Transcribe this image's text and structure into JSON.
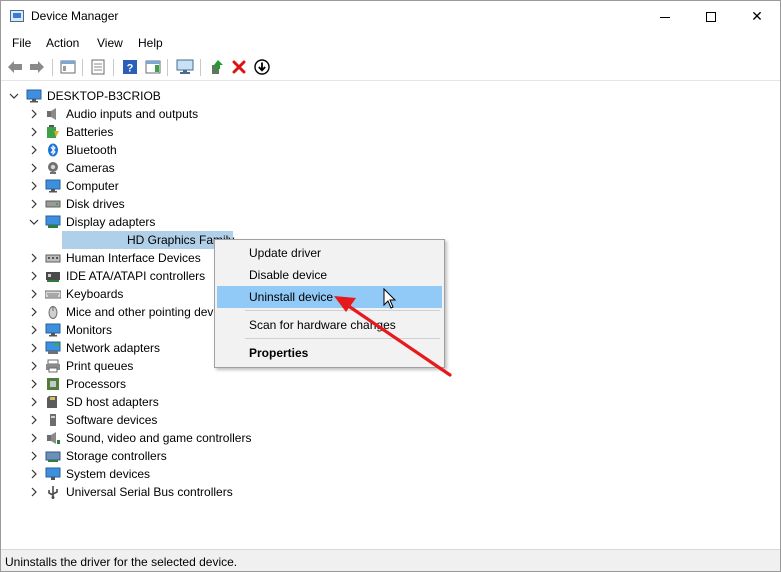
{
  "window": {
    "title": "Device Manager"
  },
  "menu": [
    "File",
    "Action",
    "View",
    "Help"
  ],
  "toolbar": {
    "icons": [
      "back-arrow-icon",
      "forward-arrow-icon",
      "console-tree-icon",
      "properties-sheet-icon",
      "help-icon",
      "action-pane-icon",
      "monitor-icon",
      "update-driver-icon",
      "uninstall-x-icon",
      "download-icon"
    ]
  },
  "tree": {
    "root": "DESKTOP-B3CRIOB",
    "categories": [
      {
        "label": "Audio inputs and outputs",
        "icon": "speaker-icon"
      },
      {
        "label": "Batteries",
        "icon": "battery-icon"
      },
      {
        "label": "Bluetooth",
        "icon": "bluetooth-icon"
      },
      {
        "label": "Cameras",
        "icon": "camera-icon"
      },
      {
        "label": "Computer",
        "icon": "computer-icon"
      },
      {
        "label": "Disk drives",
        "icon": "disk-drive-icon"
      },
      {
        "label": "Display adapters",
        "icon": "display-adapter-icon",
        "expanded": true,
        "child": "HD Graphics Family"
      },
      {
        "label": "Human Interface Devices",
        "icon": "hid-icon"
      },
      {
        "label": "IDE ATA/ATAPI controllers",
        "icon": "ide-controller-icon"
      },
      {
        "label": "Keyboards",
        "icon": "keyboard-icon"
      },
      {
        "label": "Mice and other pointing devices",
        "icon": "mouse-icon"
      },
      {
        "label": "Monitors",
        "icon": "monitor-icon"
      },
      {
        "label": "Network adapters",
        "icon": "network-adapter-icon"
      },
      {
        "label": "Print queues",
        "icon": "printer-icon"
      },
      {
        "label": "Processors",
        "icon": "processor-icon"
      },
      {
        "label": "SD host adapters",
        "icon": "sd-card-icon"
      },
      {
        "label": "Software devices",
        "icon": "software-device-icon"
      },
      {
        "label": "Sound, video and game controllers",
        "icon": "sound-controller-icon"
      },
      {
        "label": "Storage controllers",
        "icon": "storage-controller-icon"
      },
      {
        "label": "System devices",
        "icon": "system-device-icon"
      },
      {
        "label": "Universal Serial Bus controllers",
        "icon": "usb-icon"
      }
    ]
  },
  "context_menu": {
    "update_driver": "Update driver",
    "disable_device": "Disable device",
    "uninstall_device": "Uninstall device",
    "scan_hardware": "Scan for hardware changes",
    "properties": "Properties"
  },
  "status": {
    "text": "Uninstalls the driver for the selected device."
  },
  "colors": {
    "selection": "#b0cfe8",
    "menu_highlight": "#91c9f7",
    "annotation_arrow": "#e8191c"
  }
}
